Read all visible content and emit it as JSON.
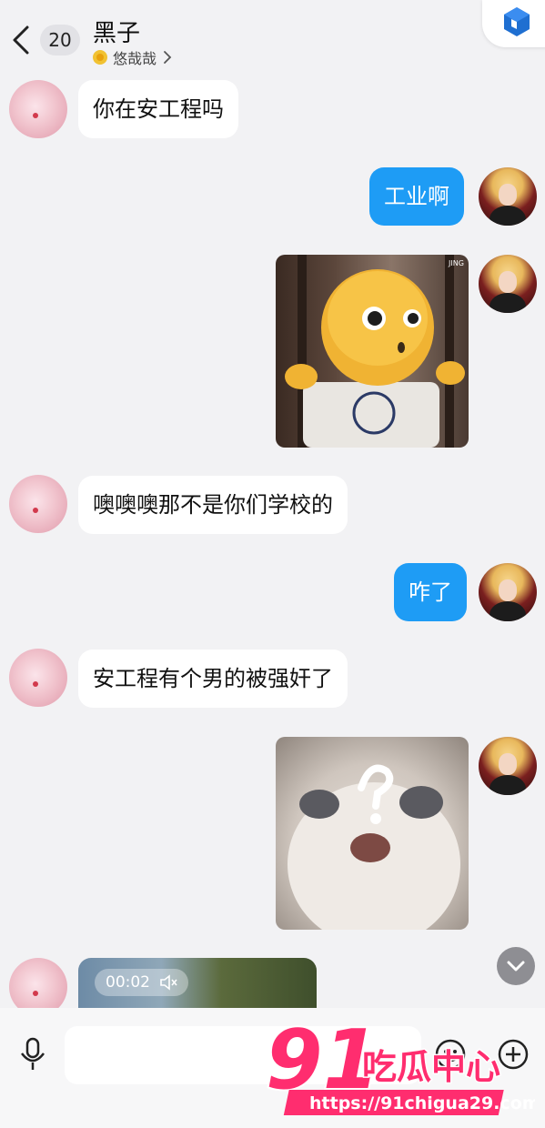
{
  "header": {
    "unread_count": "20",
    "title": "黑子",
    "subtitle": "悠哉哉"
  },
  "messages": [
    {
      "side": "left",
      "type": "text",
      "text": "你在安工程吗"
    },
    {
      "side": "right",
      "type": "text",
      "text": "工业啊"
    },
    {
      "side": "right",
      "type": "image",
      "content": "sticker-emoji-character"
    },
    {
      "side": "left",
      "type": "text",
      "text": "噢噢噢那不是你们学校的"
    },
    {
      "side": "right",
      "type": "text",
      "text": "咋了"
    },
    {
      "side": "left",
      "type": "text",
      "text": "安工程有个男的被强奸了"
    },
    {
      "side": "right",
      "type": "image",
      "content": "sticker-cat-question"
    },
    {
      "side": "left",
      "type": "video",
      "duration": "00:02"
    }
  ],
  "sticker_emoji": {
    "corner_label": "JING"
  },
  "watermark": {
    "logo_number": "91",
    "logo_text": "吃瓜中心",
    "url": "https://91chigua29.com"
  },
  "icons": {
    "back": "chevron-left-icon",
    "corner": "cube-icon",
    "mic": "microphone-icon",
    "emoji": "smiley-icon",
    "plus": "plus-circle-icon",
    "scroll_down": "chevron-down-icon",
    "mute": "speaker-muted-icon"
  }
}
